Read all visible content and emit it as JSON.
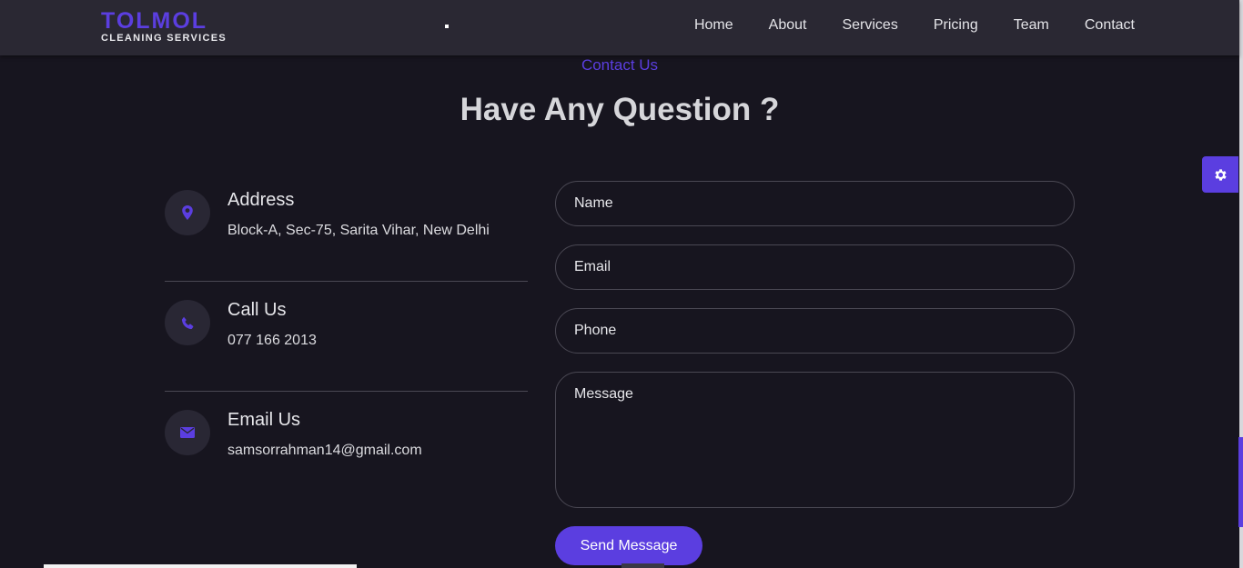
{
  "brand": {
    "name": "TOLMOL",
    "tagline": "CLEANING SERVICES"
  },
  "nav": {
    "items": [
      {
        "label": "Home"
      },
      {
        "label": "About"
      },
      {
        "label": "Services"
      },
      {
        "label": "Pricing"
      },
      {
        "label": "Team"
      },
      {
        "label": "Contact"
      }
    ]
  },
  "section": {
    "subtitle": "Contact Us",
    "title": "Have Any Question ?"
  },
  "contact_info": {
    "address": {
      "heading": "Address",
      "text": "Block-A, Sec-75, Sarita Vihar, New Delhi",
      "icon": "map-pin-icon"
    },
    "phone": {
      "heading": "Call Us",
      "text": "077 166 2013",
      "icon": "phone-icon"
    },
    "email": {
      "heading": "Email Us",
      "text": "samsorrahman14@gmail.com",
      "icon": "envelope-icon"
    }
  },
  "form": {
    "name_placeholder": "Name",
    "email_placeholder": "Email",
    "phone_placeholder": "Phone",
    "message_placeholder": "Message",
    "submit_label": "Send Message"
  },
  "settings": {
    "icon": "gear-icon"
  },
  "colors": {
    "accent": "#5b3ee0",
    "background": "#17151f",
    "header": "#2a2833",
    "icon_circle": "#292734",
    "border": "#4a4853"
  }
}
